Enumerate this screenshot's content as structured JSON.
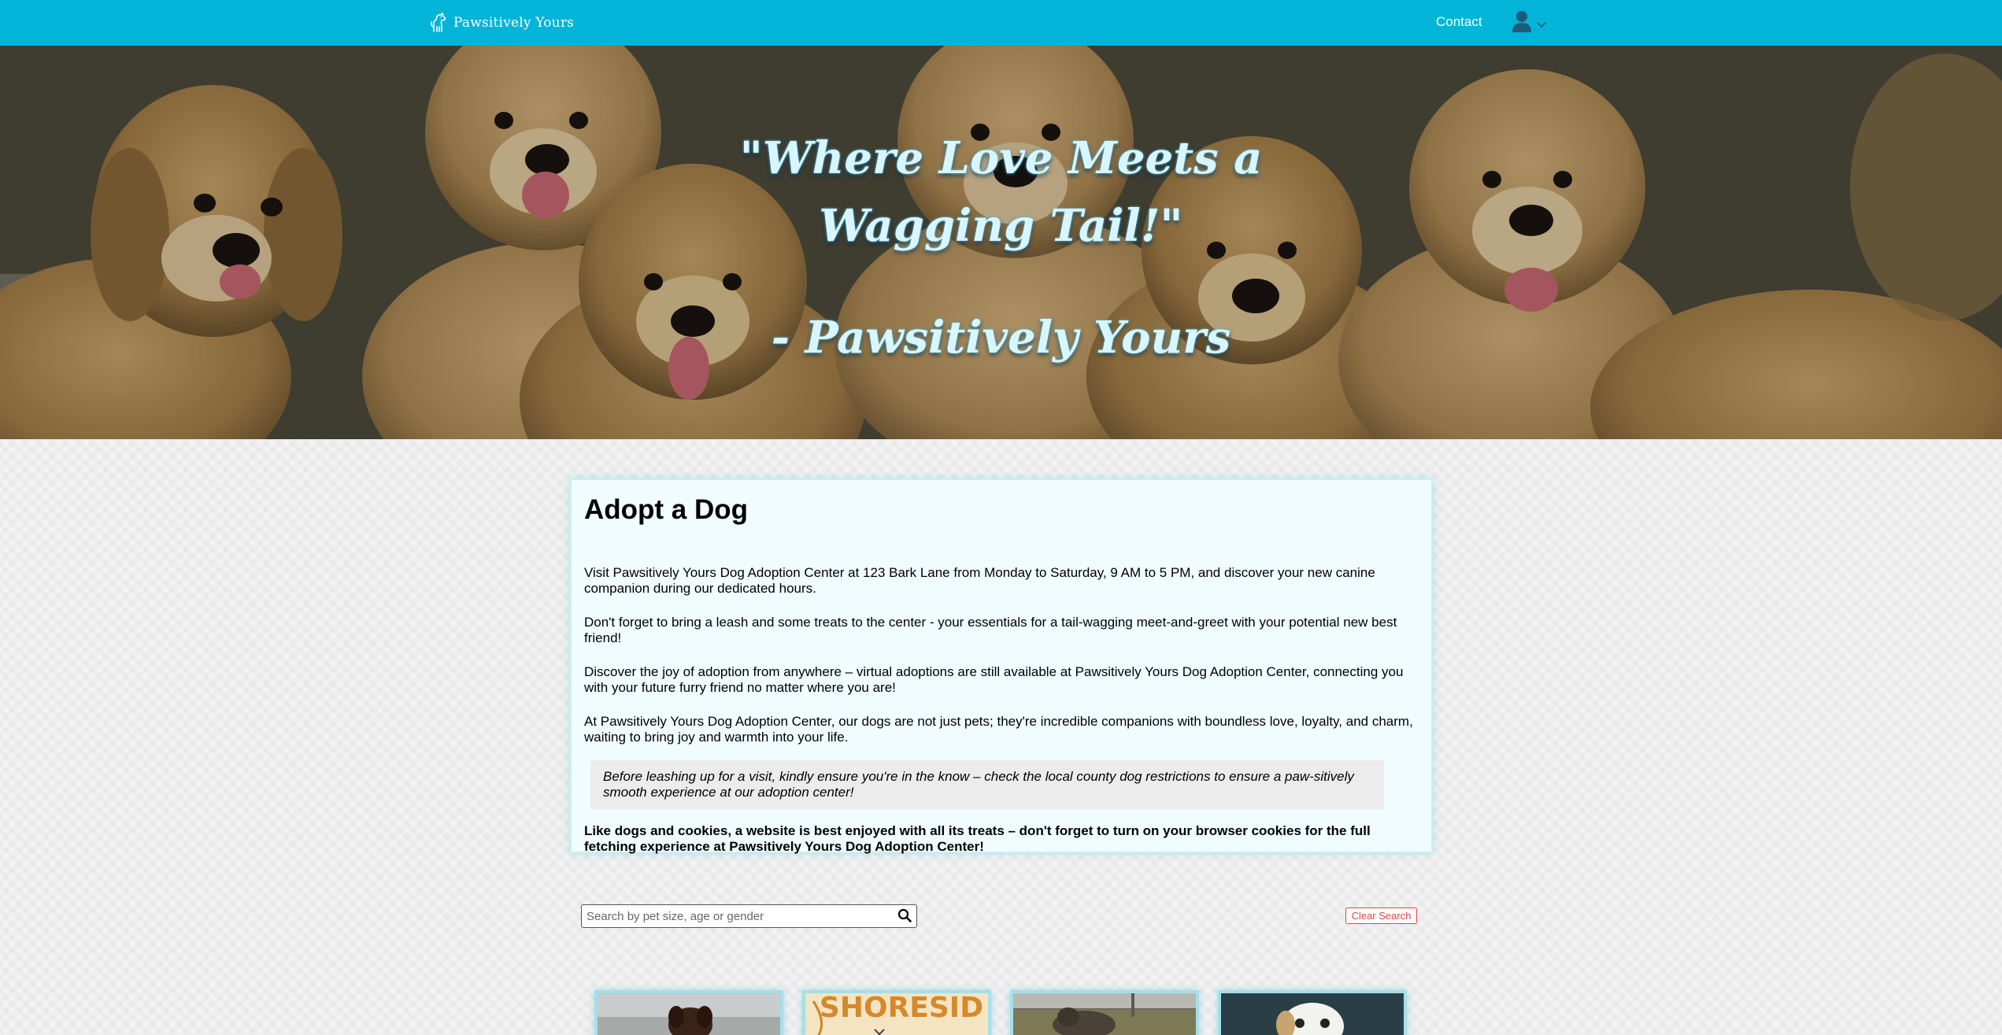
{
  "nav": {
    "brand": "Pawsitively Yours",
    "contact": "Contact",
    "icons": {
      "brand": "dog-logo-icon",
      "user": "user-icon",
      "dropdown": "chevron-down-icon"
    },
    "colors": {
      "bar": "#01b4d8",
      "text": "#ffffff"
    }
  },
  "hero": {
    "quote_line1": "\"Where Love Meets a",
    "quote_line2": "Wagging Tail!\"",
    "signature": "- Pawsitively Yours",
    "colors": {
      "quote": "#d8f6ff",
      "glow": "#56c9e6"
    }
  },
  "adopt": {
    "title": "Adopt a Dog",
    "paragraphs": [
      "Visit Pawsitively Yours Dog Adoption Center at 123 Bark Lane from Monday to Saturday, 9 AM to 5 PM, and discover your new canine companion during our dedicated hours.",
      "Don't forget to bring a leash and some treats to the center - your essentials for a tail-wagging meet-and-greet with your potential new best friend!",
      "Discover the joy of adoption from anywhere – virtual adoptions are still available at Pawsitively Yours Dog Adoption Center, connecting you with your future furry friend no matter where you are!",
      "At Pawsitively Yours Dog Adoption Center, our dogs are not just pets; they're incredible companions with boundless love, loyalty, and charm, waiting to bring joy and warmth into your life."
    ],
    "notice": "Before leashing up for a visit, kindly ensure you're in the know – check the local county dog restrictions to ensure a paw-sitively smooth experience at our adoption center!",
    "cookie_note": "Like dogs and cookies, a website is best enjoyed with all its treats – don't forget to turn on your browser cookies for the full fetching experience at Pawsitively Yours Dog Adoption Center!"
  },
  "search": {
    "placeholder": "Search by pet size, age or gender",
    "value": "",
    "icon": "search-icon",
    "clear_label": "Clear Search",
    "colors": {
      "clear": "#e04848"
    }
  },
  "dogs": {
    "cards": [
      {
        "photo": "dog-photo"
      },
      {
        "photo": "shoreside-sign-photo",
        "caption": "SHORESID"
      },
      {
        "photo": "dog-photo"
      },
      {
        "photo": "dog-photo"
      }
    ]
  }
}
